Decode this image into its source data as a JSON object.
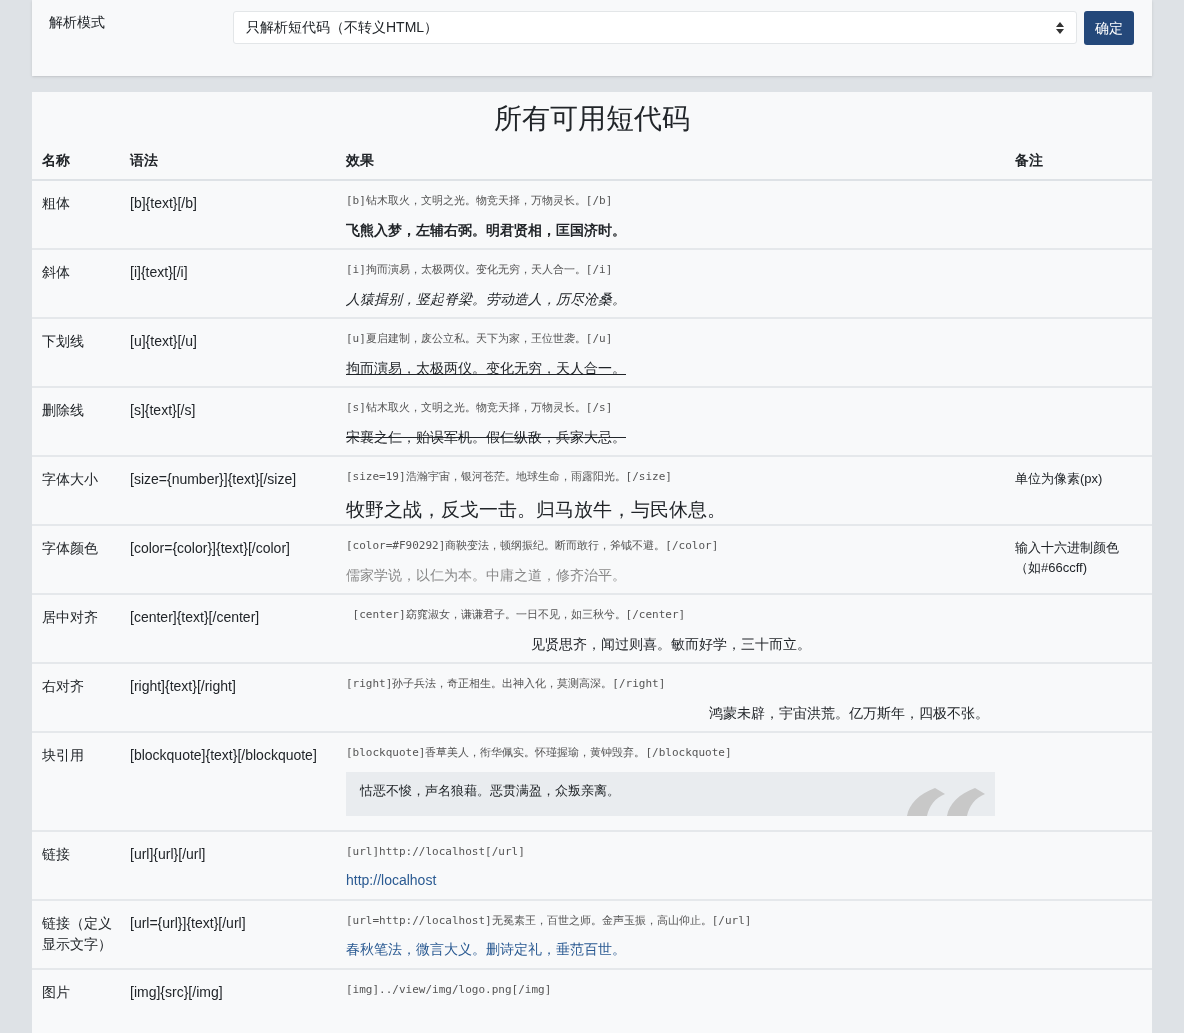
{
  "settings": {
    "label": "解析模式",
    "select_value": "只解析短代码（不转义HTML）",
    "submit": "确定"
  },
  "table": {
    "title": "所有可用短代码",
    "columns": [
      "名称",
      "语法",
      "效果",
      "备注"
    ],
    "rows": [
      {
        "name": "粗体",
        "syntax": "[b]{text}[/b]",
        "code": "[b]钻木取火，文明之光。物竞天择，万物灵长。[/b]",
        "kind": "bold",
        "effect": "飞熊入梦，左辅右弼。明君贤相，匡国济时。"
      },
      {
        "name": "斜体",
        "syntax": "[i]{text}[/i]",
        "code": "[i]拘而演易，太极两仪。变化无穷，天人合一。[/i]",
        "kind": "italic",
        "effect": "人猿揖别，竖起脊梁。劳动造人，历尽沧桑。"
      },
      {
        "name": "下划线",
        "syntax": "[u]{text}[/u]",
        "code": "[u]夏启建制，废公立私。天下为家，王位世袭。[/u]",
        "kind": "underline",
        "effect": "拘而演易，太极两仪。变化无穷，天人合一。"
      },
      {
        "name": "删除线",
        "syntax": "[s]{text}[/s]",
        "code": "[s]钻木取火，文明之光。物竞天择，万物灵长。[/s]",
        "kind": "strike",
        "effect": "宋襄之仁，贻误军机。假仁纵敌，兵家大忌。"
      },
      {
        "name": "字体大小",
        "syntax": "[size={number}]{text}[/size]",
        "code": "[size=19]浩瀚宇宙，银河苍茫。地球生命，雨露阳光。[/size]",
        "kind": "size",
        "effect": "牧野之战，反戈一击。归马放牛，与民休息。",
        "note": "单位为像素(px)"
      },
      {
        "name": "字体颜色",
        "syntax": "[color={color}]{text}[/color]",
        "code": "[color=#F90292]商鞅变法，顿纲振纪。断而敢行，斧钺不避。[/color]",
        "kind": "color",
        "effect": "儒家学说，以仁为本。中庸之道，修齐治平。",
        "note": "输入十六进制颜色（如#66ccff)"
      },
      {
        "name": "居中对齐",
        "syntax": "[center]{text}[/center]",
        "code": " [center]窈窕淑女，谦谦君子。一日不见，如三秋兮。[/center]",
        "kind": "center",
        "effect": "见贤思齐，闻过则喜。敏而好学，三十而立。"
      },
      {
        "name": "右对齐",
        "syntax": "[right]{text}[/right]",
        "code": "[right]孙子兵法，奇正相生。出神入化，莫测高深。[/right]",
        "kind": "right",
        "effect": "鸿蒙未辟，宇宙洪荒。亿万斯年，四极不张。"
      },
      {
        "name": "块引用",
        "syntax": "[blockquote]{text}[/blockquote]",
        "code": "[blockquote]香草美人，衔华佩实。怀瑾握瑜，黄钟毁弃。[/blockquote]",
        "kind": "blockquote",
        "effect": "怙恶不悛，声名狼藉。恶贯满盈，众叛亲离。"
      },
      {
        "name": "链接",
        "syntax": "[url]{url}[/url]",
        "code": "[url]http://localhost[/url]",
        "kind": "link",
        "effect": "http://localhost"
      },
      {
        "name": "链接（定义显示文字）",
        "syntax": "[url={url}]{text}[/url]",
        "code": "[url=http://localhost]无冕素王，百世之师。金声玉振，高山仰止。[/url]",
        "kind": "link",
        "effect": "春秋笔法，微言大义。删诗定礼，垂范百世。"
      },
      {
        "name": "图片",
        "syntax": "[img]{src}[/img]",
        "code": "[img]../view/img/logo.png[/img]",
        "kind": "image"
      }
    ]
  }
}
